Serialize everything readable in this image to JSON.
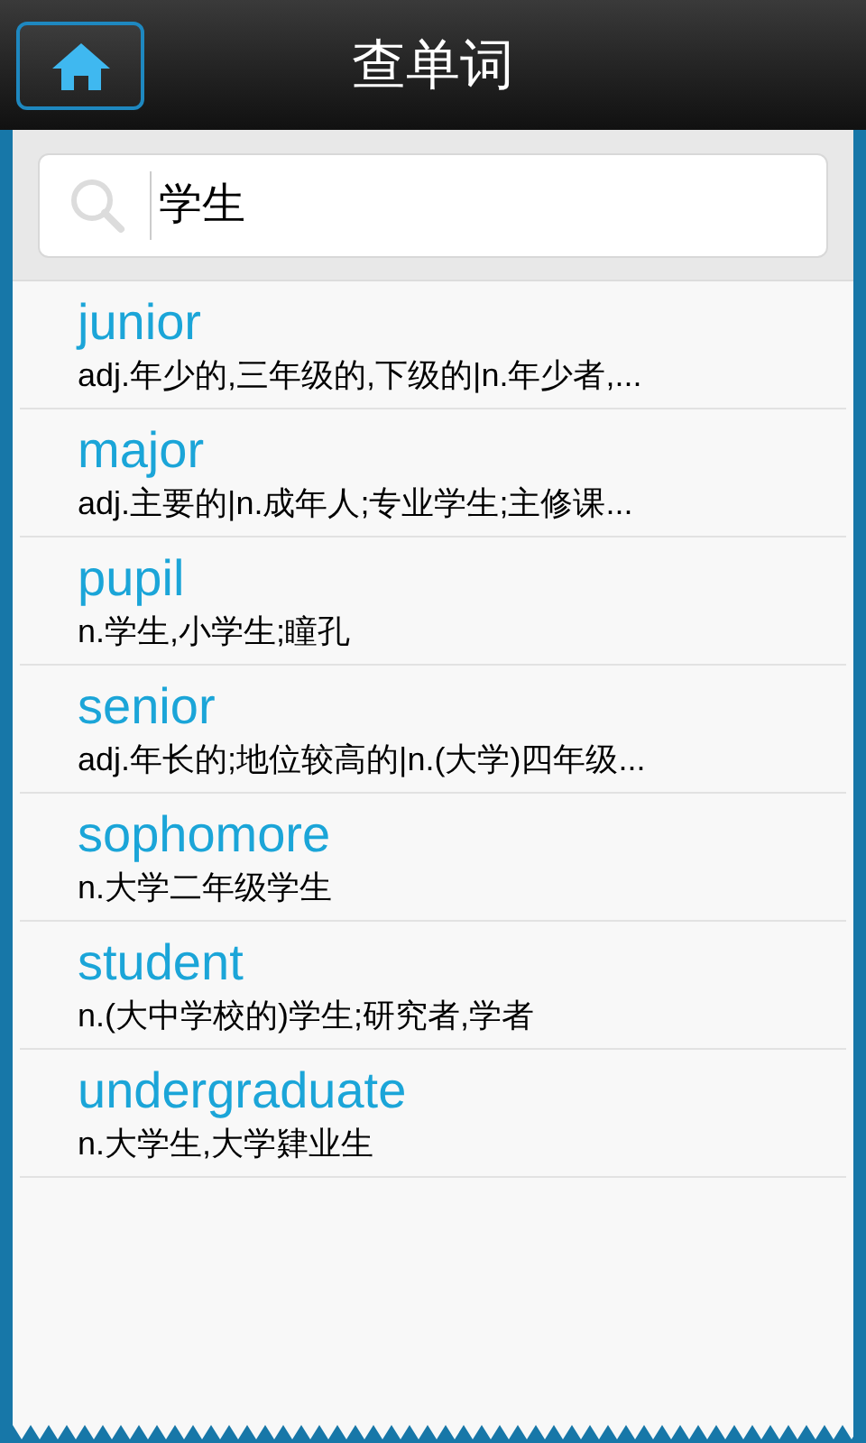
{
  "header": {
    "title": "查单词"
  },
  "search": {
    "value": "学生"
  },
  "results": [
    {
      "word": "junior",
      "definition": "adj.年少的,三年级的,下级的|n.年少者,..."
    },
    {
      "word": "major",
      "definition": "adj.主要的|n.成年人;专业学生;主修课..."
    },
    {
      "word": "pupil",
      "definition": "n.学生,小学生;瞳孔"
    },
    {
      "word": "senior",
      "definition": "adj.年长的;地位较高的|n.(大学)四年级..."
    },
    {
      "word": "sophomore",
      "definition": "n.大学二年级学生"
    },
    {
      "word": "student",
      "definition": "n.(大中学校的)学生;研究者,学者"
    },
    {
      "word": "undergraduate",
      "definition": "n.大学生,大学肄业生"
    }
  ]
}
